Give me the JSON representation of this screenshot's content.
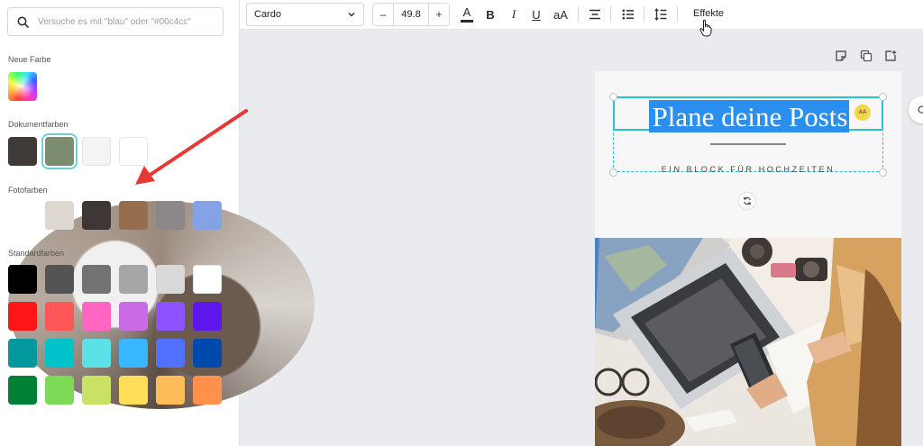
{
  "search": {
    "placeholder": "Versuche es mit \"blau\" oder \"#00c4cc\""
  },
  "sections": {
    "new_color": "Neue Farbe",
    "document_colors": "Dokumentfarben",
    "photo_colors": "Fotofarben",
    "standard_colors": "Standardfarben"
  },
  "document_colors": [
    "#3f3937",
    "#7b8c70",
    "#f4f4f5",
    "#ffffff"
  ],
  "photo_colors": [
    "#ddd8d2",
    "#3e3736",
    "#966e4e",
    "#8d8789",
    "#86a2e6"
  ],
  "standard_colors": [
    [
      "#000000",
      "#545454",
      "#737373",
      "#a6a6a6",
      "#d9d9d9",
      "#ffffff"
    ],
    [
      "#ff1616",
      "#ff5757",
      "#ff66c4",
      "#cb6ce6",
      "#8c52ff",
      "#5e17eb"
    ],
    [
      "#03989e",
      "#00c2cb",
      "#5ce1e6",
      "#38b6ff",
      "#5271ff",
      "#004aad"
    ],
    [
      "#008037",
      "#7ed957",
      "#c9e265",
      "#ffde59",
      "#ffbd59",
      "#ff914d"
    ]
  ],
  "toolbar": {
    "font": "Cardo",
    "font_size": "49.8",
    "minus": "–",
    "plus": "+",
    "text_color": "A",
    "bold": "B",
    "italic": "I",
    "underline": "U",
    "case": "aA",
    "effects": "Effekte"
  },
  "design": {
    "title": "Plane deine Posts",
    "subtitle": "EIN BLOCK FÜR HOCHZEITEN",
    "badge": "AA"
  },
  "colors": {
    "accent": "#26c4cf",
    "highlight": "#2b8ff0",
    "arrow": "#e53935"
  }
}
